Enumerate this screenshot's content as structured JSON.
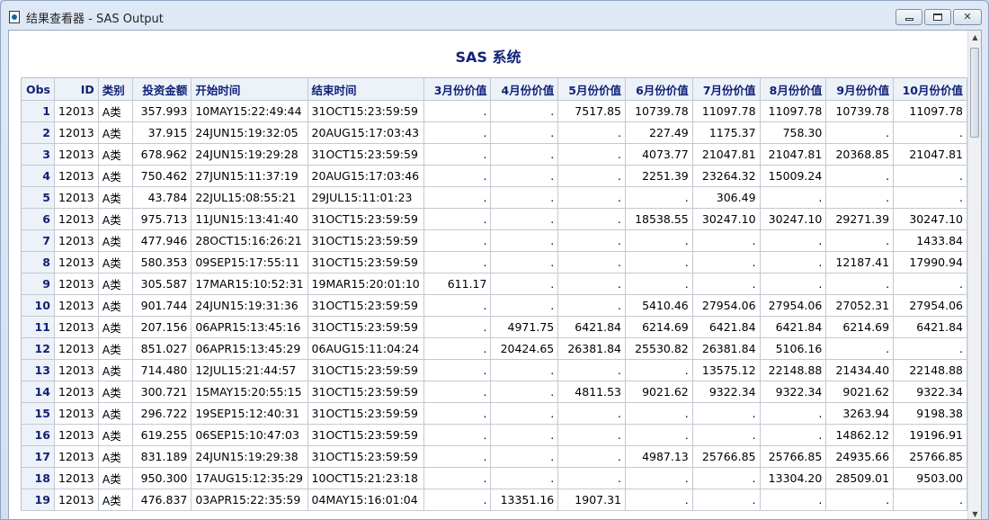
{
  "window": {
    "title": "结果查看器 - SAS Output",
    "icon": "sas-output-icon"
  },
  "report": {
    "title": "SAS 系统"
  },
  "table": {
    "headers": [
      "Obs",
      "ID",
      "类别",
      "投资金额",
      "开始时间",
      "结束时间",
      "3月份价值",
      "4月份价值",
      "5月份价值",
      "6月份价值",
      "7月份价值",
      "8月份价值",
      "9月份价值",
      "10月份价值"
    ],
    "rows": [
      [
        "1",
        "12013",
        "A类",
        "357.993",
        "10MAY15:22:49:44",
        "31OCT15:23:59:59",
        ".",
        ".",
        "7517.85",
        "10739.78",
        "11097.78",
        "11097.78",
        "10739.78",
        "11097.78"
      ],
      [
        "2",
        "12013",
        "A类",
        "37.915",
        "24JUN15:19:32:05",
        "20AUG15:17:03:43",
        ".",
        ".",
        ".",
        "227.49",
        "1175.37",
        "758.30",
        ".",
        "."
      ],
      [
        "3",
        "12013",
        "A类",
        "678.962",
        "24JUN15:19:29:28",
        "31OCT15:23:59:59",
        ".",
        ".",
        ".",
        "4073.77",
        "21047.81",
        "21047.81",
        "20368.85",
        "21047.81"
      ],
      [
        "4",
        "12013",
        "A类",
        "750.462",
        "27JUN15:11:37:19",
        "20AUG15:17:03:46",
        ".",
        ".",
        ".",
        "2251.39",
        "23264.32",
        "15009.24",
        ".",
        "."
      ],
      [
        "5",
        "12013",
        "A类",
        "43.784",
        "22JUL15:08:55:21",
        "29JUL15:11:01:23",
        ".",
        ".",
        ".",
        ".",
        "306.49",
        ".",
        ".",
        "."
      ],
      [
        "6",
        "12013",
        "A类",
        "975.713",
        "11JUN15:13:41:40",
        "31OCT15:23:59:59",
        ".",
        ".",
        ".",
        "18538.55",
        "30247.10",
        "30247.10",
        "29271.39",
        "30247.10"
      ],
      [
        "7",
        "12013",
        "A类",
        "477.946",
        "28OCT15:16:26:21",
        "31OCT15:23:59:59",
        ".",
        ".",
        ".",
        ".",
        ".",
        ".",
        ".",
        "1433.84"
      ],
      [
        "8",
        "12013",
        "A类",
        "580.353",
        "09SEP15:17:55:11",
        "31OCT15:23:59:59",
        ".",
        ".",
        ".",
        ".",
        ".",
        ".",
        "12187.41",
        "17990.94"
      ],
      [
        "9",
        "12013",
        "A类",
        "305.587",
        "17MAR15:10:52:31",
        "19MAR15:20:01:10",
        "611.17",
        ".",
        ".",
        ".",
        ".",
        ".",
        ".",
        "."
      ],
      [
        "10",
        "12013",
        "A类",
        "901.744",
        "24JUN15:19:31:36",
        "31OCT15:23:59:59",
        ".",
        ".",
        ".",
        "5410.46",
        "27954.06",
        "27954.06",
        "27052.31",
        "27954.06"
      ],
      [
        "11",
        "12013",
        "A类",
        "207.156",
        "06APR15:13:45:16",
        "31OCT15:23:59:59",
        ".",
        "4971.75",
        "6421.84",
        "6214.69",
        "6421.84",
        "6421.84",
        "6214.69",
        "6421.84"
      ],
      [
        "12",
        "12013",
        "A类",
        "851.027",
        "06APR15:13:45:29",
        "06AUG15:11:04:24",
        ".",
        "20424.65",
        "26381.84",
        "25530.82",
        "26381.84",
        "5106.16",
        ".",
        "."
      ],
      [
        "13",
        "12013",
        "A类",
        "714.480",
        "12JUL15:21:44:57",
        "31OCT15:23:59:59",
        ".",
        ".",
        ".",
        ".",
        "13575.12",
        "22148.88",
        "21434.40",
        "22148.88"
      ],
      [
        "14",
        "12013",
        "A类",
        "300.721",
        "15MAY15:20:55:15",
        "31OCT15:23:59:59",
        ".",
        ".",
        "4811.53",
        "9021.62",
        "9322.34",
        "9322.34",
        "9021.62",
        "9322.34"
      ],
      [
        "15",
        "12013",
        "A类",
        "296.722",
        "19SEP15:12:40:31",
        "31OCT15:23:59:59",
        ".",
        ".",
        ".",
        ".",
        ".",
        ".",
        "3263.94",
        "9198.38"
      ],
      [
        "16",
        "12013",
        "A类",
        "619.255",
        "06SEP15:10:47:03",
        "31OCT15:23:59:59",
        ".",
        ".",
        ".",
        ".",
        ".",
        ".",
        "14862.12",
        "19196.91"
      ],
      [
        "17",
        "12013",
        "A类",
        "831.189",
        "24JUN15:19:29:38",
        "31OCT15:23:59:59",
        ".",
        ".",
        ".",
        "4987.13",
        "25766.85",
        "25766.85",
        "24935.66",
        "25766.85"
      ],
      [
        "18",
        "12013",
        "A类",
        "950.300",
        "17AUG15:12:35:29",
        "10OCT15:21:23:18",
        ".",
        ".",
        ".",
        ".",
        ".",
        "13304.20",
        "28509.01",
        "9503.00"
      ],
      [
        "19",
        "12013",
        "A类",
        "476.837",
        "03APR15:22:35:59",
        "04MAY15:16:01:04",
        ".",
        "13351.16",
        "1907.31",
        ".",
        ".",
        ".",
        ".",
        "."
      ]
    ]
  }
}
